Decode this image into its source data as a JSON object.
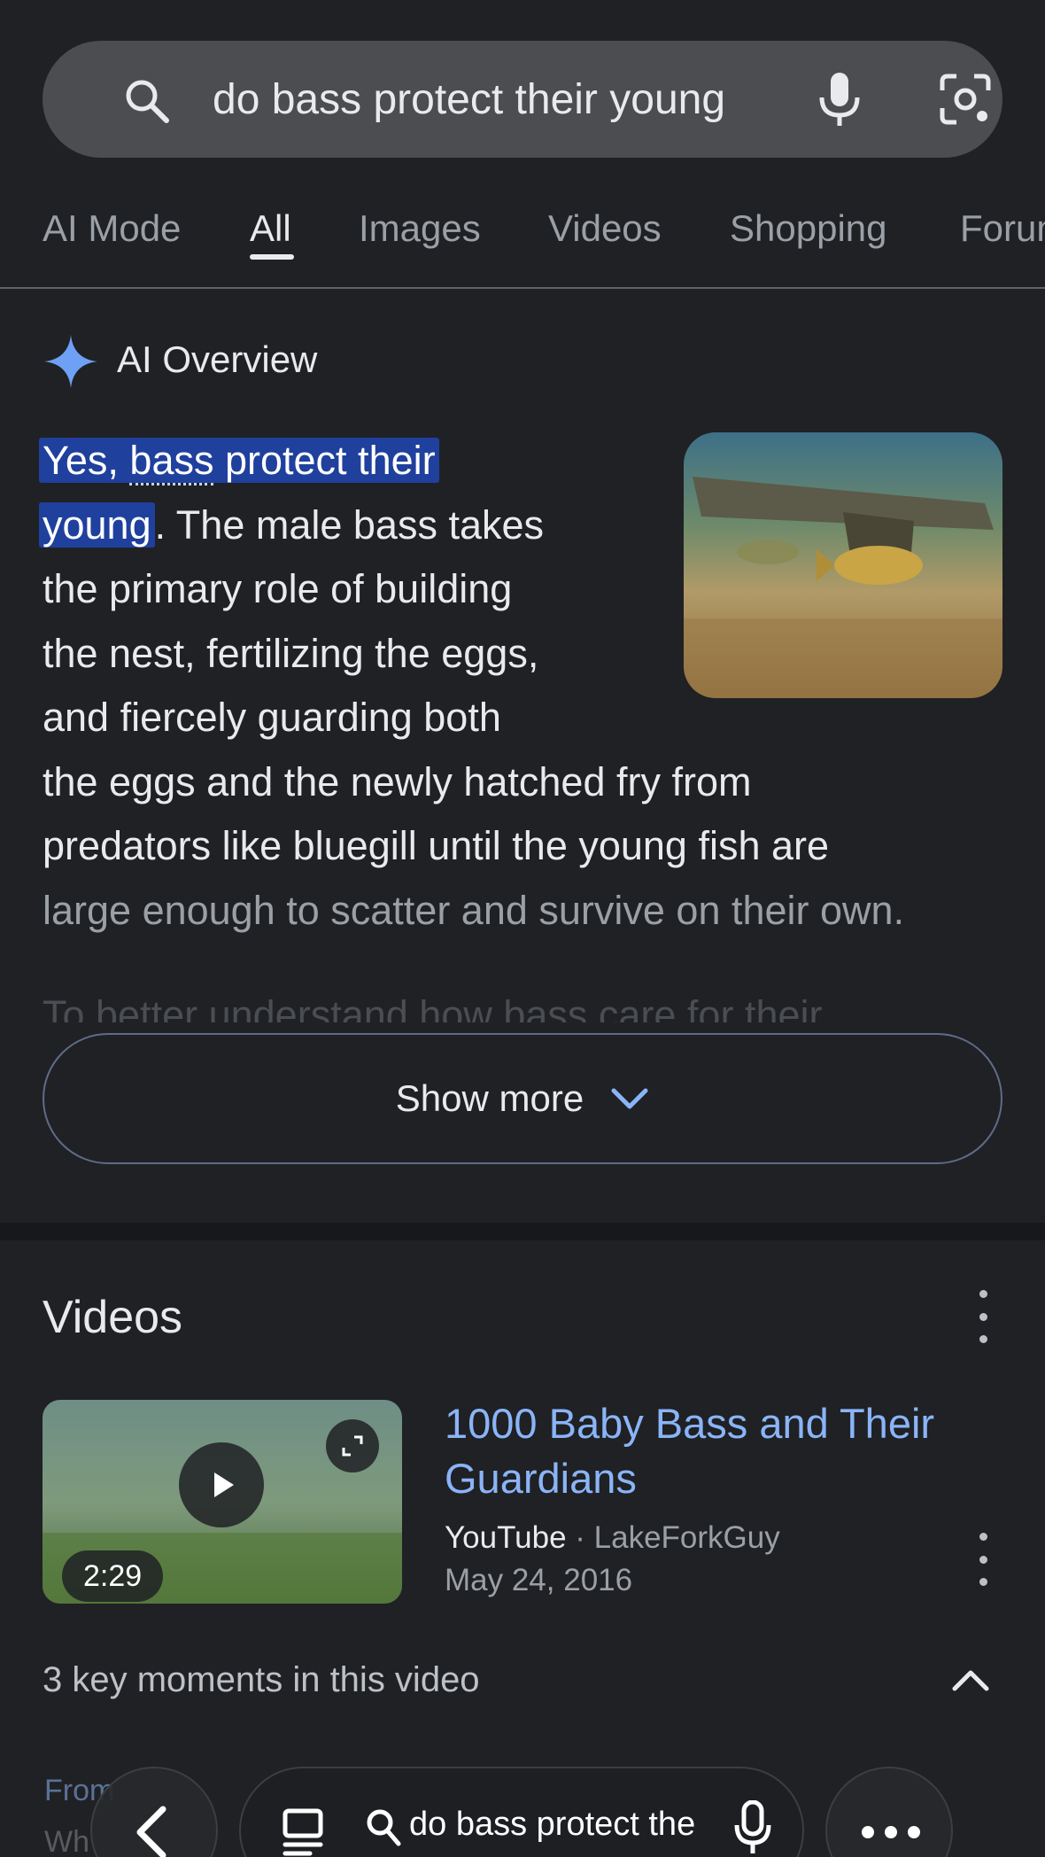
{
  "search": {
    "query": "do bass protect their young"
  },
  "tabs": [
    {
      "label": "AI Mode"
    },
    {
      "label": "All"
    },
    {
      "label": "Images"
    },
    {
      "label": "Videos"
    },
    {
      "label": "Shopping"
    },
    {
      "label": "Forums"
    }
  ],
  "ai_overview": {
    "title": "AI Overview",
    "line1_hl_a": "Yes, ",
    "line1_hl_link": "bass",
    "line1_hl_b": " protect their",
    "line2_hl": "young",
    "line2_rest": ". The male bass takes",
    "line3": "the primary role of building",
    "line4": "the nest, fertilizing the eggs,",
    "line5": "and fiercely guarding both",
    "line6": "the eggs and the newly hatched fry from",
    "line7": "predators like bluegill until the young fish are",
    "line8": "large enough to scatter and survive on their own.",
    "line9": "To better understand how bass care for their",
    "show_more_label": "Show more"
  },
  "videos": {
    "section_title": "Videos",
    "item": {
      "title": "1000 Baby Bass and Their Guardians",
      "source": "YouTube",
      "separator": " · ",
      "author": "LakeForkGuy",
      "date": "May 24, 2016",
      "duration": "2:29"
    },
    "key_moments_label": "3 key moments in this video",
    "peek_line1": "From",
    "peek_line2": "Wh"
  },
  "bottom_bar": {
    "query": "do bass protect the"
  },
  "colors": {
    "background": "#202124",
    "link": "#8ab4f8",
    "highlight": "#20409e",
    "gemini_star": "#6ea0f5"
  }
}
